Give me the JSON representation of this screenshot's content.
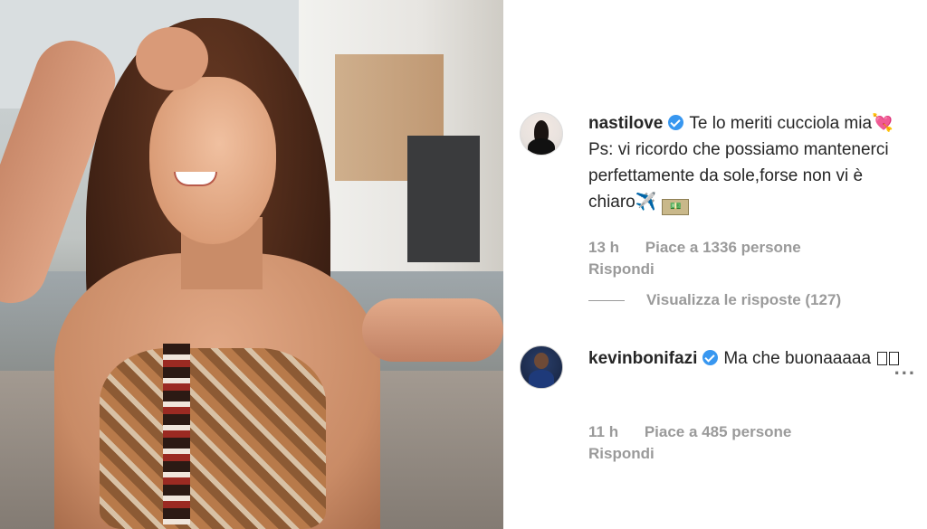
{
  "photo": {
    "description_icon": "photo-post"
  },
  "comments": [
    {
      "username": "nastilove",
      "text_part1": "Te lo meriti cucciola mia",
      "text_part2": "Ps: vi ricordo che possiamo mantenerci perfettamente da sole,forse non vi è chiaro",
      "emoji_1": "💘",
      "emoji_2": "✈️",
      "time": "13 h",
      "likes": "Piace a 1336 persone",
      "reply": "Rispondi",
      "view_replies": "Visualizza le risposte (127)"
    },
    {
      "username": "kevinbonifazi",
      "text": "Ma che buonaaaaa",
      "time": "11 h",
      "likes": "Piace a 485 persone",
      "reply": "Rispondi",
      "more": "..."
    }
  ],
  "colors": {
    "verified": "#3897f0",
    "text": "#262626",
    "meta": "#9a9a9a"
  }
}
